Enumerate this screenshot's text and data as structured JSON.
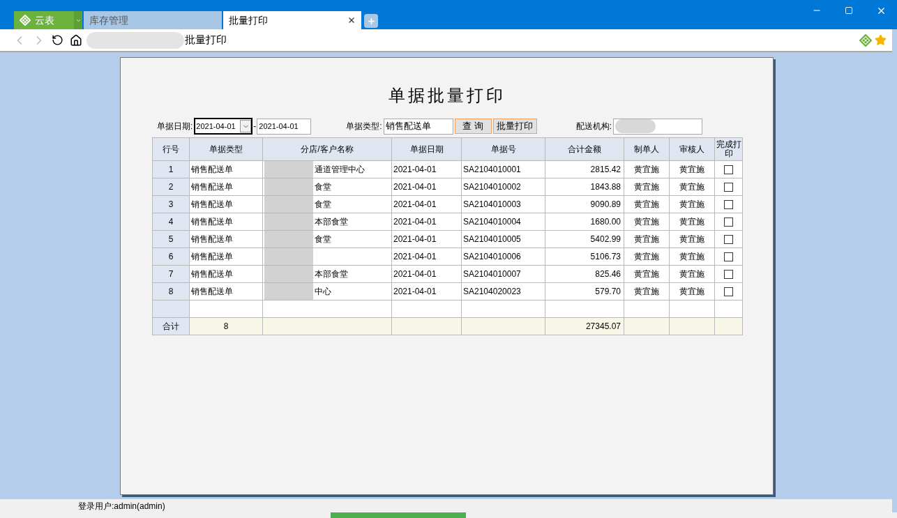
{
  "app_tab": {
    "label": "云表"
  },
  "tabs": [
    {
      "label": "库存管理",
      "selected": false
    },
    {
      "label": "批量打印",
      "selected": true
    }
  ],
  "address": {
    "text": "批量打印"
  },
  "page": {
    "title": "单据批量打印",
    "filters": {
      "date_label": "单据日期:",
      "date_from": "2021-04-01",
      "date_sep": "-",
      "date_to": "2021-04-01",
      "type_label": "单据类型:",
      "type_value": "销售配送单",
      "query_button": "查 询",
      "print_button": "批量打印",
      "org_label": "配送机构:"
    },
    "table": {
      "columns": [
        "行号",
        "单据类型",
        "分店/客户名称",
        "单据日期",
        "单据号",
        "合计金额",
        "制单人",
        "审核人",
        "完成打印"
      ],
      "rows": [
        {
          "no": "1",
          "type": "销售配送单",
          "customer": "通道管理中心",
          "date": "2021-04-01",
          "doc": "SA2104010001",
          "amount": "2815.42",
          "maker": "黄宜施",
          "auditor": "黄宜施",
          "checked": false
        },
        {
          "no": "2",
          "type": "销售配送单",
          "customer": "食堂",
          "date": "2021-04-01",
          "doc": "SA2104010002",
          "amount": "1843.88",
          "maker": "黄宜施",
          "auditor": "黄宜施",
          "checked": false
        },
        {
          "no": "3",
          "type": "销售配送单",
          "customer": "食堂",
          "date": "2021-04-01",
          "doc": "SA2104010003",
          "amount": "9090.89",
          "maker": "黄宜施",
          "auditor": "黄宜施",
          "checked": false
        },
        {
          "no": "4",
          "type": "销售配送单",
          "customer": "本部食堂",
          "date": "2021-04-01",
          "doc": "SA2104010004",
          "amount": "1680.00",
          "maker": "黄宜施",
          "auditor": "黄宜施",
          "checked": false
        },
        {
          "no": "5",
          "type": "销售配送单",
          "customer": "食堂",
          "date": "2021-04-01",
          "doc": "SA2104010005",
          "amount": "5402.99",
          "maker": "黄宜施",
          "auditor": "黄宜施",
          "checked": false
        },
        {
          "no": "6",
          "type": "销售配送单",
          "date": "2021-04-01",
          "doc": "SA2104010006",
          "amount": "5106.73",
          "maker": "黄宜施",
          "auditor": "黄宜施",
          "checked": false
        },
        {
          "no": "7",
          "type": "销售配送单",
          "customer": "本部食堂",
          "date": "2021-04-01",
          "doc": "SA2104010007",
          "amount": "825.46",
          "maker": "黄宜施",
          "auditor": "黄宜施",
          "checked": false
        },
        {
          "no": "8",
          "type": "销售配送单",
          "customer": "中心",
          "date": "2021-04-01",
          "doc": "SA2104020023",
          "amount": "579.70",
          "maker": "黄宜施",
          "auditor": "黄宜施",
          "checked": false
        }
      ],
      "total": {
        "label": "合计",
        "count": "8",
        "amount": "27345.07"
      }
    }
  },
  "status_bar": {
    "user": "登录用户:admin(admin)"
  }
}
